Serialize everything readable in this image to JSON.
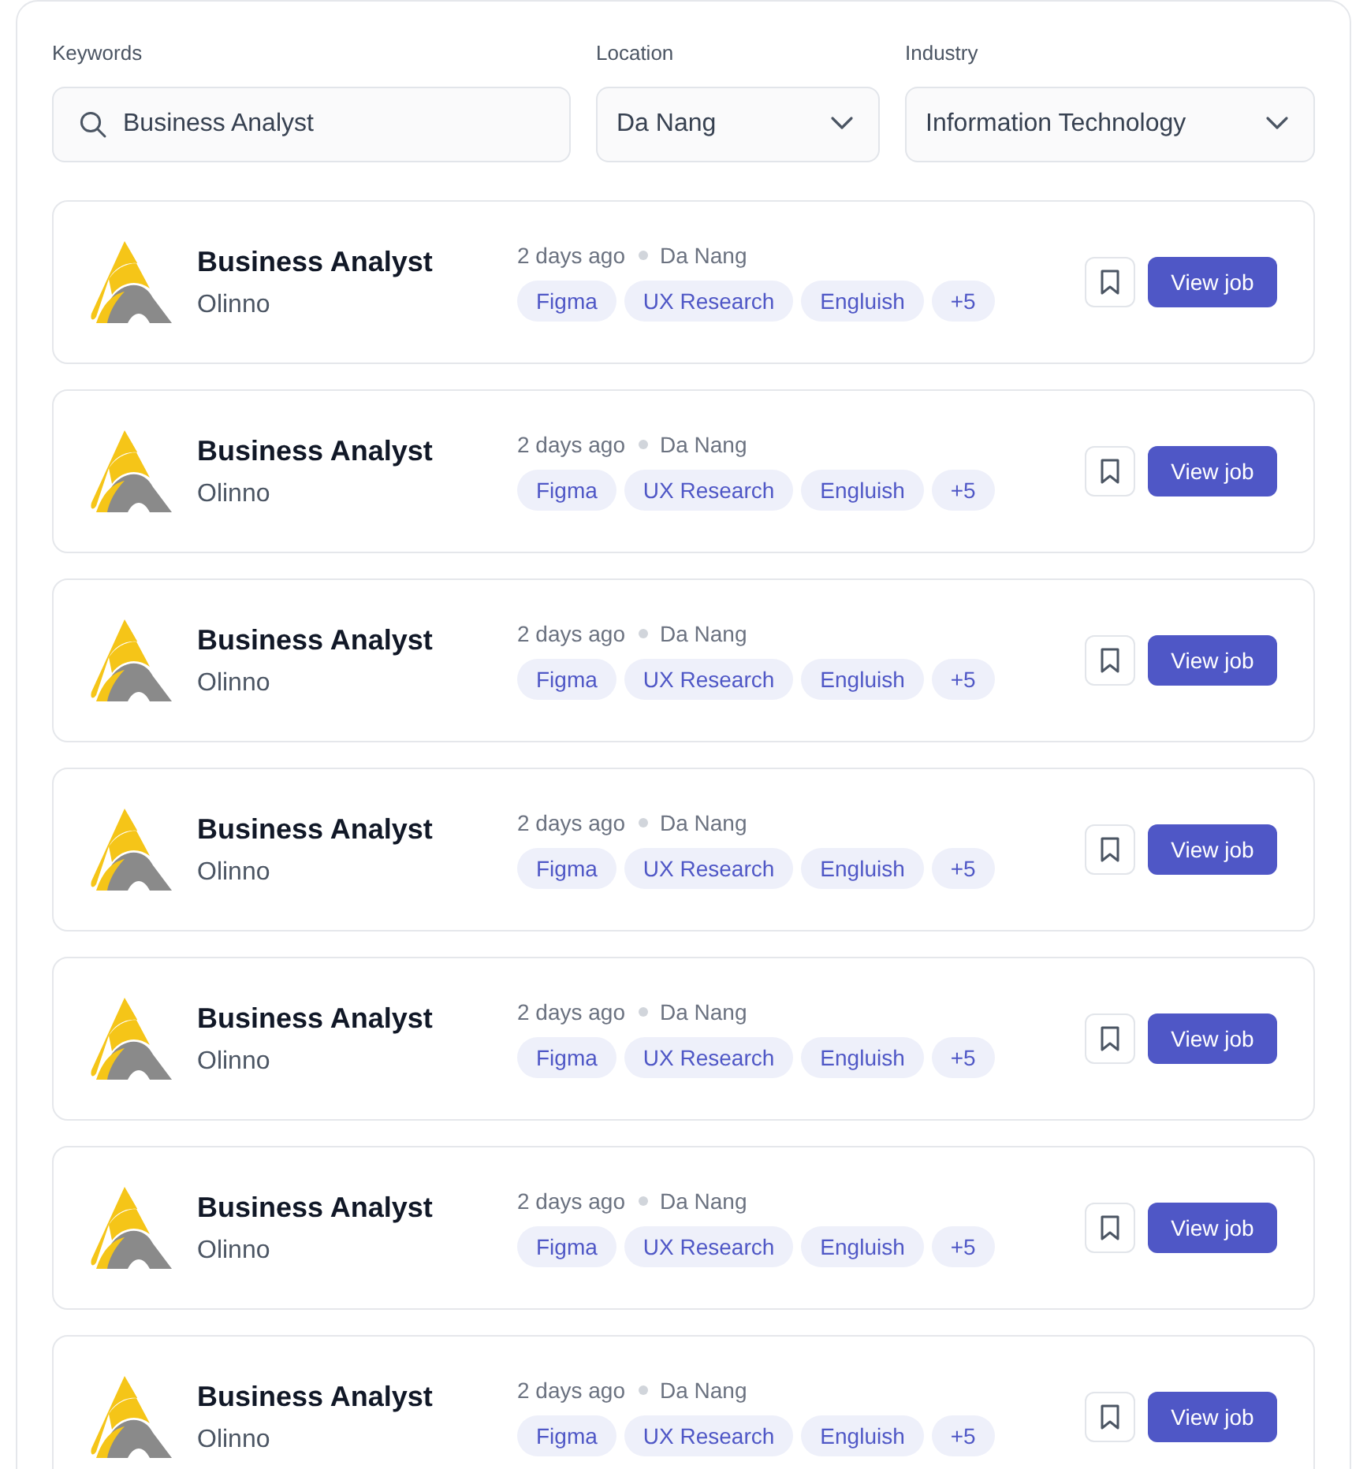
{
  "filters": {
    "keywords": {
      "label": "Keywords",
      "value": "Business Analyst"
    },
    "location": {
      "label": "Location",
      "value": "Da Nang"
    },
    "industry": {
      "label": "Industry",
      "value": "Information Technology"
    }
  },
  "jobs": [
    {
      "title": "Business Analyst",
      "company": "Olinno",
      "posted": "2 days ago",
      "location": "Da Nang",
      "tags": [
        "Figma",
        "UX Research",
        "Engluish",
        "+5"
      ],
      "action": "View job"
    },
    {
      "title": "Business Analyst",
      "company": "Olinno",
      "posted": "2 days ago",
      "location": "Da Nang",
      "tags": [
        "Figma",
        "UX Research",
        "Engluish",
        "+5"
      ],
      "action": "View job"
    },
    {
      "title": "Business Analyst",
      "company": "Olinno",
      "posted": "2 days ago",
      "location": "Da Nang",
      "tags": [
        "Figma",
        "UX Research",
        "Engluish",
        "+5"
      ],
      "action": "View job"
    },
    {
      "title": "Business Analyst",
      "company": "Olinno",
      "posted": "2 days ago",
      "location": "Da Nang",
      "tags": [
        "Figma",
        "UX Research",
        "Engluish",
        "+5"
      ],
      "action": "View job"
    },
    {
      "title": "Business Analyst",
      "company": "Olinno",
      "posted": "2 days ago",
      "location": "Da Nang",
      "tags": [
        "Figma",
        "UX Research",
        "Engluish",
        "+5"
      ],
      "action": "View job"
    },
    {
      "title": "Business Analyst",
      "company": "Olinno",
      "posted": "2 days ago",
      "location": "Da Nang",
      "tags": [
        "Figma",
        "UX Research",
        "Engluish",
        "+5"
      ],
      "action": "View job"
    },
    {
      "title": "Business Analyst",
      "company": "Olinno",
      "posted": "2 days ago",
      "location": "Da Nang",
      "tags": [
        "Figma",
        "UX Research",
        "Engluish",
        "+5"
      ],
      "action": "View job"
    }
  ]
}
